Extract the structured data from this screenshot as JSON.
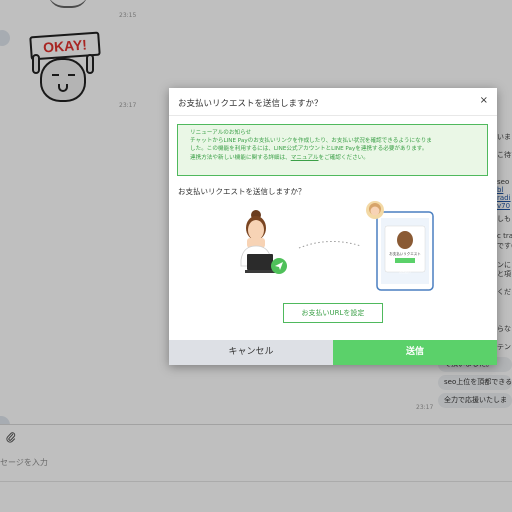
{
  "chat": {
    "timestamps": [
      "23:15",
      "23:17",
      "23:17"
    ],
    "sticker_text": "OKAY!",
    "right_fragments": [
      {
        "text": "いま",
        "kind": "text"
      },
      {
        "text": "こ待ち",
        "kind": "text"
      },
      {
        "text": "seo",
        "kind": "text"
      },
      {
        "text": "bl",
        "kind": "link"
      },
      {
        "text": "radi",
        "kind": "link"
      },
      {
        "text": "v70",
        "kind": "link"
      },
      {
        "text": "しも",
        "kind": "text"
      },
      {
        "text": "c traf",
        "kind": "text"
      },
      {
        "text": "です(",
        "kind": "text"
      },
      {
        "text": "ンに",
        "kind": "text"
      },
      {
        "text": "と項目",
        "kind": "text"
      },
      {
        "text": "くだ",
        "kind": "text"
      },
      {
        "text": "らな",
        "kind": "text"
      },
      {
        "text": "テン",
        "kind": "text"
      }
    ],
    "bubbles": [
      "て頂いました。",
      "seo上位を頂都できる",
      "全力で応援いたしま"
    ]
  },
  "composer": {
    "placeholder": "セージを入力"
  },
  "modal": {
    "title": "お支払いリクエストを送信しますか？",
    "close_label": "×",
    "notice": {
      "heading": "リニューアルのお知らせ",
      "line1": "チャットからLINE Payのお支払いリンクを作成したり、お支払い状況を確認できるようになりま",
      "line2": "した。この機能を利用するには、LINE公式アカウントとLINE Payを連携する必要があります。",
      "line3_before": "連携方法や新しい機能に関する詳細は、",
      "line3_link": "マニュアル",
      "line3_after": "をご確認ください。"
    },
    "subtitle": "お支払いリクエストを送信しますか？",
    "phone_card_title": "お支払いリクエスト",
    "phone_card_button": "お支払い",
    "url_button": "お支払いURLを設定",
    "cancel_button": "キャンセル",
    "send_button": "送信"
  },
  "colors": {
    "line_green": "#5bd16a",
    "notice_green": "#3ba047",
    "notice_bg": "#eaf7e6",
    "cancel_gray": "#dde0e5"
  }
}
